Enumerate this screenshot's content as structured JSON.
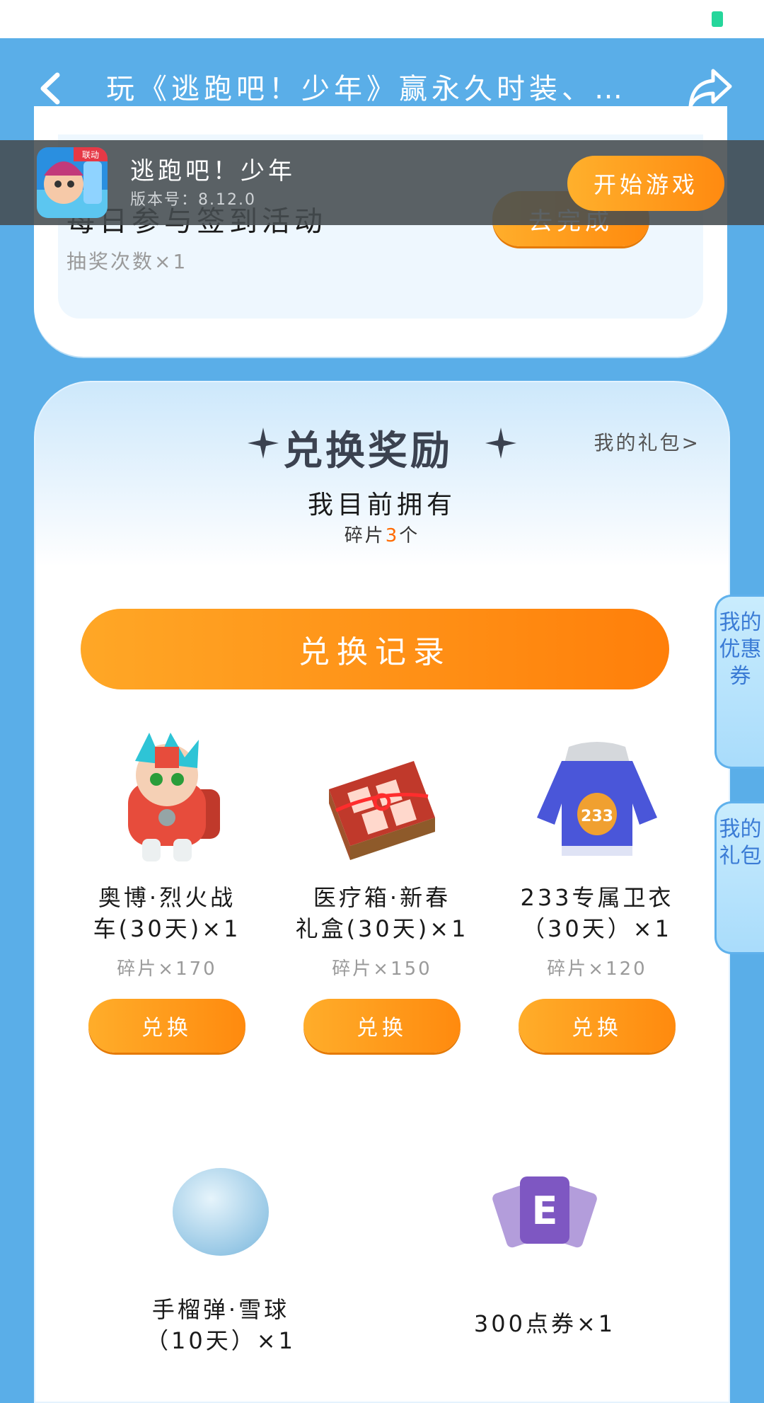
{
  "header": {
    "title": "玩《逃跑吧！少年》赢永久时装、道...",
    "back_icon": "chevron-left-icon",
    "share_icon": "share-arrow-icon"
  },
  "game_bar": {
    "name": "逃跑吧！少年",
    "version": "版本号：8.12.0",
    "icon_badge": "联动",
    "start_label": "开始游戏"
  },
  "task": {
    "title": "每日参与签到活动",
    "subtitle": "抽奖次数×1",
    "button_label": "去完成"
  },
  "rewards": {
    "title": "兑换奖励",
    "my_gift_link": "我的礼包>",
    "own_title": "我目前拥有",
    "own_prefix": "碎片",
    "own_count": "3",
    "own_suffix": "个",
    "record_label": "兑换记录",
    "items": [
      {
        "name_line1": "奥博·烈火战",
        "name_line2": "车(30天)×1",
        "cost": "碎片×170",
        "button": "兑换",
        "icon": "robot-car-icon"
      },
      {
        "name_line1": "医疗箱·新春",
        "name_line2": "礼盒(30天)×1",
        "cost": "碎片×150",
        "button": "兑换",
        "icon": "gift-box-icon"
      },
      {
        "name_line1": "233专属卫衣",
        "name_line2": "（30天）×1",
        "cost": "碎片×120",
        "button": "兑换",
        "icon": "hoodie-icon"
      },
      {
        "name_line1": "手榴弹·雪球",
        "name_line2": "（10天）×1",
        "icon": "snowball-icon"
      },
      {
        "name_line1": "300点券×1",
        "name_line2": "",
        "icon": "coupon-cards-icon"
      }
    ]
  },
  "side_tabs": {
    "coupons": "我的优惠券",
    "gifts": "我的礼包"
  },
  "colors": {
    "background": "#5aaee8",
    "accent_orange": "#ff8a0e",
    "status_green": "#25d69b"
  }
}
